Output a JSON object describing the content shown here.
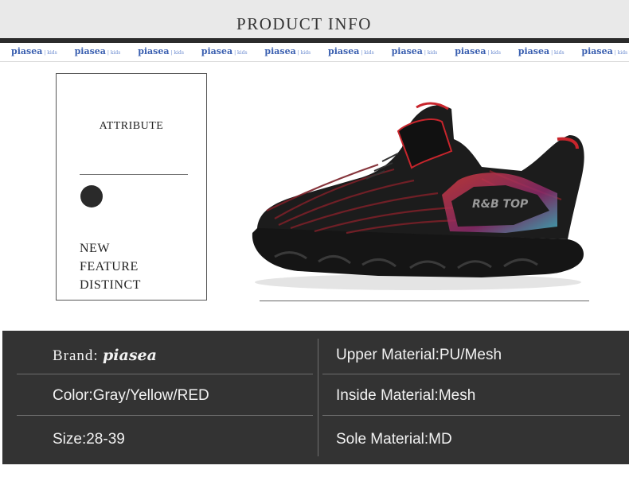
{
  "header": {
    "title": "PRODUCT  INFO"
  },
  "logo_strip": {
    "brand": "piasea",
    "suffix": "kids",
    "count": 10
  },
  "attributes": {
    "label": "ATTRIBUTE",
    "features": [
      "NEW",
      "FEATURE",
      "DISTINCT"
    ]
  },
  "product_image": {
    "subject": "black and red kids knit sneaker with velcro strap",
    "print": "R&B TOP"
  },
  "specs": {
    "brand_label": "Brand:",
    "brand_logo": "piasea",
    "color": "Color:Gray/Yellow/RED",
    "size": "Size:28-39",
    "upper_material": "Upper Material:PU/Mesh",
    "inside_material": "Inside Material:Mesh",
    "sole_material": "Sole Material:MD"
  },
  "colors": {
    "header_bg": "#e9e9e9",
    "dark_bar": "#2b2b2b",
    "spec_bg": "#333333",
    "logo_blue": "#3a5fb0",
    "accent_red": "#c8252c"
  }
}
